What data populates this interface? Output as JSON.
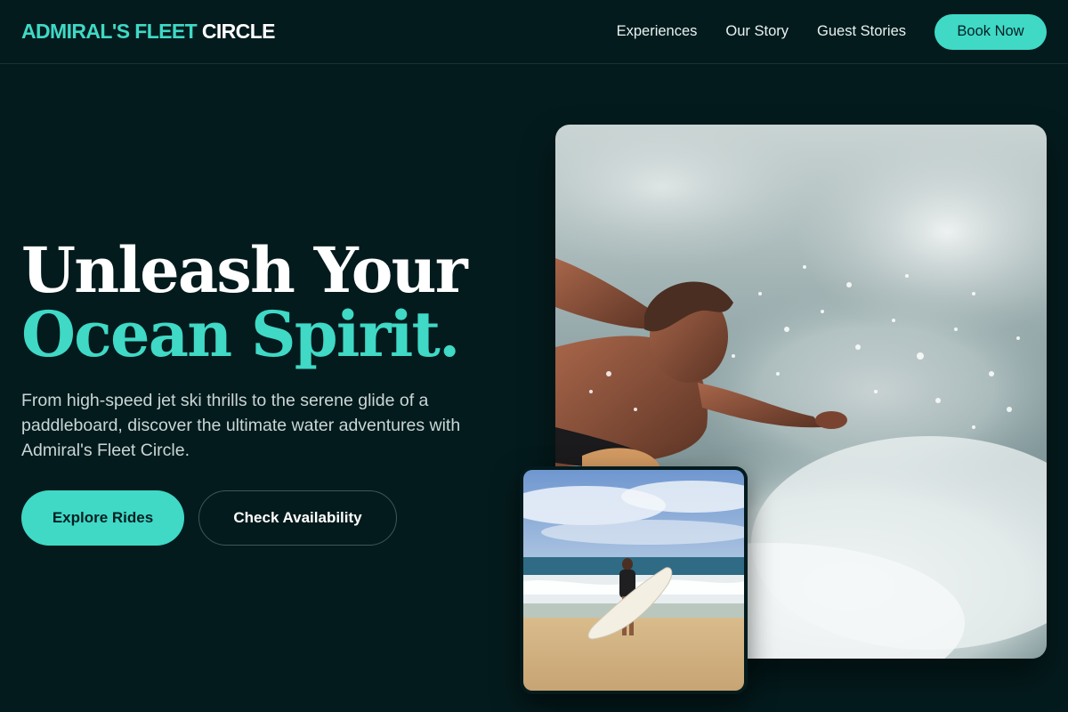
{
  "brand": {
    "accent_text": "ADMIRAL'S FLEET",
    "plain_text": "CIRCLE",
    "accent_color": "#3fd9c6"
  },
  "nav": {
    "links": [
      "Experiences",
      "Our Story",
      "Guest Stories"
    ],
    "cta": "Book Now"
  },
  "hero": {
    "title_line1": "Unleash Your",
    "title_line2": "Ocean Spirit.",
    "description": "From high-speed jet ski thrills to the serene glide of a paddleboard, discover the ultimate water adventures with Admiral's Fleet Circle.",
    "primary_button": "Explore Rides",
    "secondary_button": "Check Availability"
  },
  "images": {
    "main": "surfer-splash-photo",
    "secondary": "beach-surfboard-photo"
  },
  "colors": {
    "background": "#041b1d",
    "accent": "#3fd9c6",
    "text": "#ffffff",
    "muted_text": "#c9d6d6"
  }
}
